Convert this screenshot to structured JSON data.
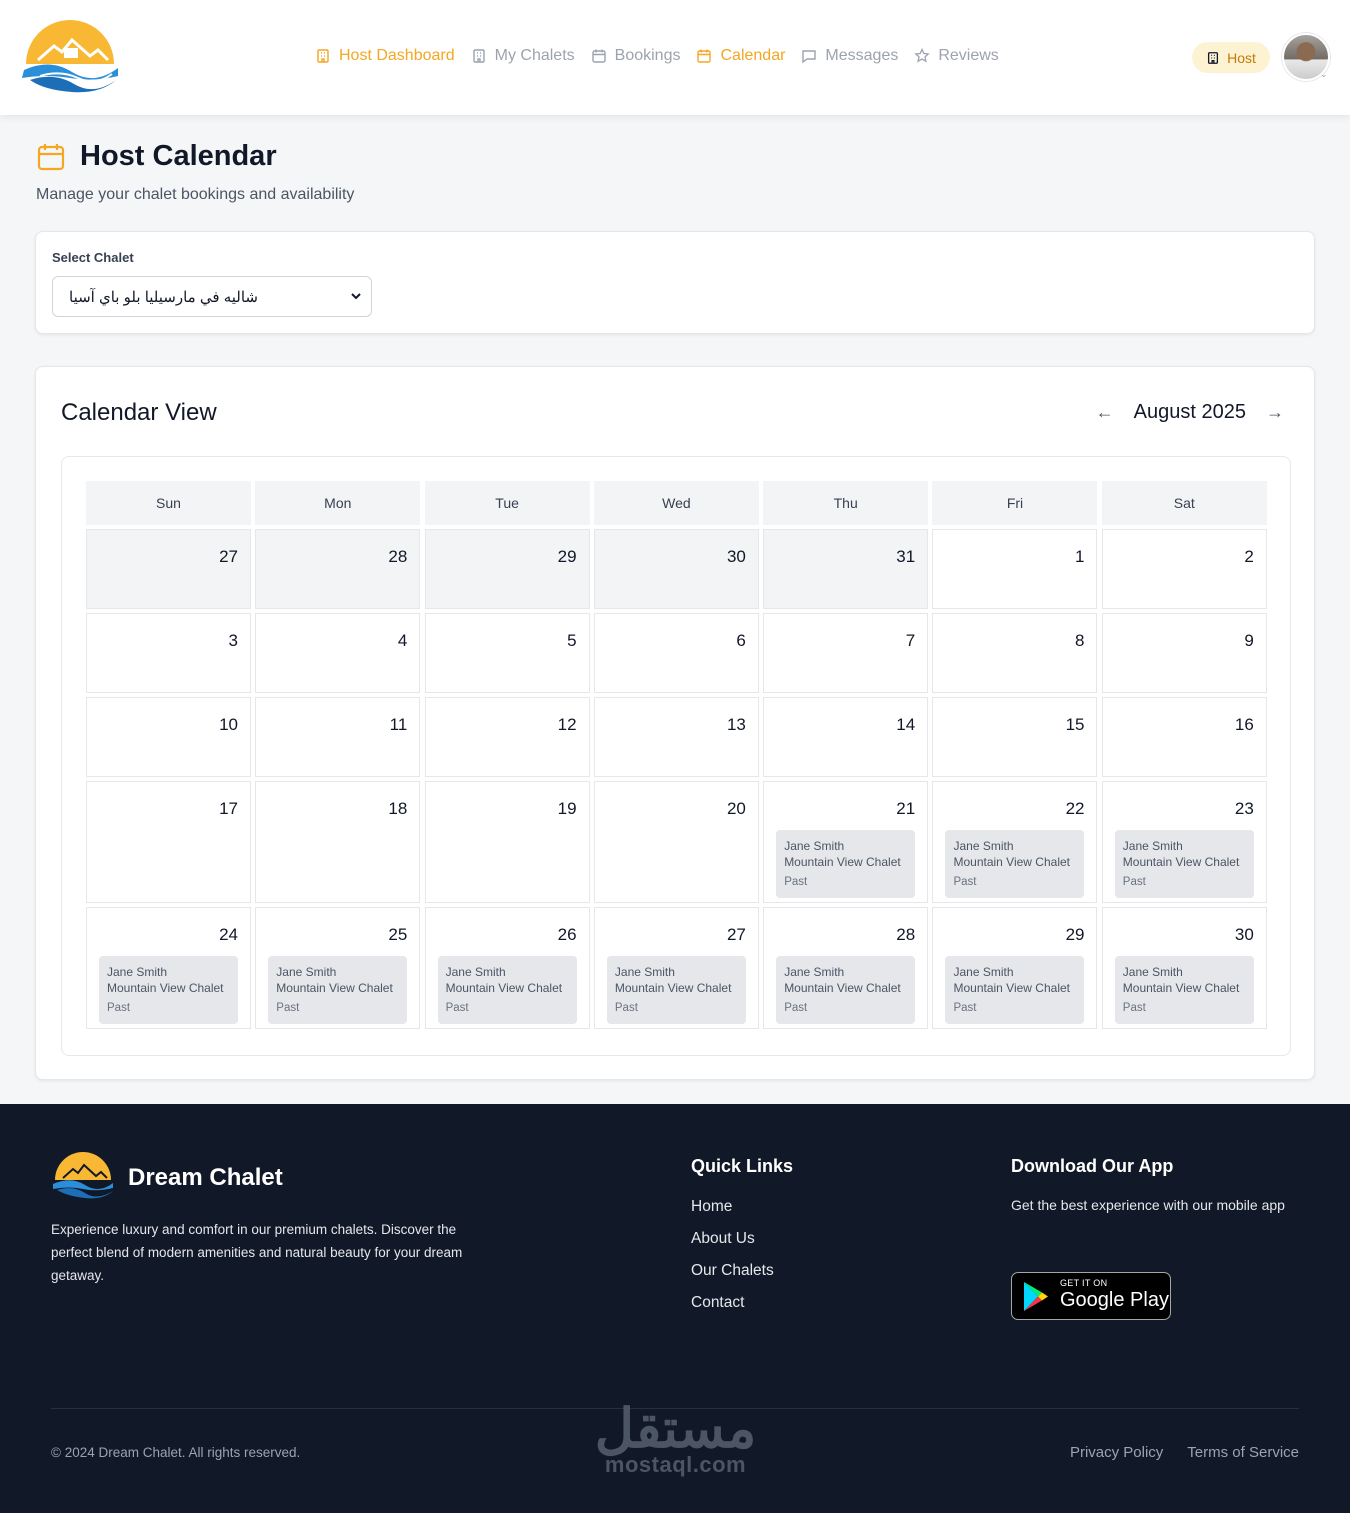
{
  "header": {
    "nav": [
      {
        "label": "Host Dashboard",
        "icon": "building-icon",
        "active": true
      },
      {
        "label": "My Chalets",
        "icon": "building-icon",
        "active": false
      },
      {
        "label": "Bookings",
        "icon": "calendar-icon",
        "active": false
      },
      {
        "label": "Calendar",
        "icon": "calendar-icon",
        "active": true
      },
      {
        "label": "Messages",
        "icon": "message-icon",
        "active": false
      },
      {
        "label": "Reviews",
        "icon": "star-icon",
        "active": false
      }
    ],
    "role_badge": "Host"
  },
  "page": {
    "title": "Host Calendar",
    "subtitle": "Manage your chalet bookings and availability"
  },
  "select": {
    "label": "Select Chalet",
    "value": "شاليه في مارسيليا بلو باي آسيا"
  },
  "calendar": {
    "title": "Calendar View",
    "month": "August 2025",
    "prev": "←",
    "next": "→",
    "weekdays": [
      "Sun",
      "Mon",
      "Tue",
      "Wed",
      "Thu",
      "Fri",
      "Sat"
    ],
    "weeks": [
      [
        {
          "d": "27",
          "out": true
        },
        {
          "d": "28",
          "out": true
        },
        {
          "d": "29",
          "out": true
        },
        {
          "d": "30",
          "out": true
        },
        {
          "d": "31",
          "out": true
        },
        {
          "d": "1"
        },
        {
          "d": "2"
        }
      ],
      [
        {
          "d": "3"
        },
        {
          "d": "4"
        },
        {
          "d": "5"
        },
        {
          "d": "6"
        },
        {
          "d": "7"
        },
        {
          "d": "8"
        },
        {
          "d": "9"
        }
      ],
      [
        {
          "d": "10"
        },
        {
          "d": "11"
        },
        {
          "d": "12"
        },
        {
          "d": "13"
        },
        {
          "d": "14"
        },
        {
          "d": "15"
        },
        {
          "d": "16"
        }
      ],
      [
        {
          "d": "17"
        },
        {
          "d": "18"
        },
        {
          "d": "19"
        },
        {
          "d": "20"
        },
        {
          "d": "21",
          "booking": {
            "guest": "Jane Smith",
            "chalet": "Mountain View Chalet",
            "status": "Past"
          }
        },
        {
          "d": "22",
          "booking": {
            "guest": "Jane Smith",
            "chalet": "Mountain View Chalet",
            "status": "Past"
          }
        },
        {
          "d": "23",
          "booking": {
            "guest": "Jane Smith",
            "chalet": "Mountain View Chalet",
            "status": "Past"
          }
        }
      ],
      [
        {
          "d": "24",
          "booking": {
            "guest": "Jane Smith",
            "chalet": "Mountain View Chalet",
            "status": "Past"
          }
        },
        {
          "d": "25",
          "booking": {
            "guest": "Jane Smith",
            "chalet": "Mountain View Chalet",
            "status": "Past"
          }
        },
        {
          "d": "26",
          "booking": {
            "guest": "Jane Smith",
            "chalet": "Mountain View Chalet",
            "status": "Past"
          }
        },
        {
          "d": "27",
          "booking": {
            "guest": "Jane Smith",
            "chalet": "Mountain View Chalet",
            "status": "Past"
          }
        },
        {
          "d": "28",
          "booking": {
            "guest": "Jane Smith",
            "chalet": "Mountain View Chalet",
            "status": "Past"
          }
        },
        {
          "d": "29",
          "booking": {
            "guest": "Jane Smith",
            "chalet": "Mountain View Chalet",
            "status": "Past"
          }
        },
        {
          "d": "30",
          "booking": {
            "guest": "Jane Smith",
            "chalet": "Mountain View Chalet",
            "status": "Past"
          }
        }
      ]
    ]
  },
  "footer": {
    "brand": "Dream Chalet",
    "description": "Experience luxury and comfort in our premium chalets. Discover the perfect blend of modern amenities and natural beauty for your dream getaway.",
    "quick_links_title": "Quick Links",
    "quick_links": [
      "Home",
      "About Us",
      "Our Chalets",
      "Contact"
    ],
    "app_title": "Download Our App",
    "app_desc": "Get the best experience with our mobile app",
    "gplay_small": "GET IT ON",
    "gplay_big": "Google Play",
    "copyright": "© 2024 Dream Chalet. All rights reserved.",
    "legal": [
      "Privacy Policy",
      "Terms of Service"
    ],
    "watermark_ar": "مستقل",
    "watermark_en": "mostaql.com"
  },
  "colors": {
    "accent": "#f5a623",
    "footer_bg": "#111827",
    "booking_bg": "#e5e7eb"
  }
}
